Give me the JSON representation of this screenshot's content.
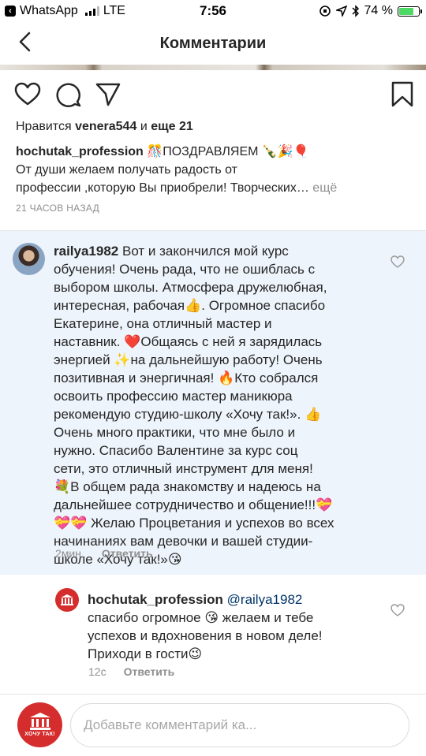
{
  "status_bar": {
    "back_app": "WhatsApp",
    "carrier": "LTE",
    "time": "7:56",
    "battery": "74 %",
    "battery_level": 0.74
  },
  "nav": {
    "title": "Комментарии"
  },
  "post": {
    "likes_prefix": "Нравится",
    "likes_user": "venera544",
    "likes_middle": "и",
    "likes_rest": "еще 21",
    "caption_user": "hochutak_profession",
    "caption_line1": "🎊ПОЗДРАВЛЯЕМ 🍾🎉🎈",
    "caption_line2": "От души желаем  получать радость от",
    "caption_line3": "профессии ,которую Вы приобрели! Творческих…",
    "more_label": "ещё",
    "time_ago": "21 ЧАСОВ НАЗАД"
  },
  "comment": {
    "user": "railya1982",
    "lines": [
      "Вот и закончился мой курс",
      "обучения! Очень рада, что не ошиблась с",
      "выбором школы. Атмосфера дружелюбная,",
      "интересная, рабочая👍. Огромное спасибо",
      "Екатерине, она отличный мастер и",
      "наставник. ❤️Общаясь с ней я зарядилась",
      "энергией ✨на дальнейшую работу!  Очень",
      "позитивная и энергичная! 🔥Кто собрался",
      "освоить профессию мастер маникюра",
      "рекомендую студию-школу «Хочу так!». 👍",
      "Очень много практики, что мне было и",
      "нужно. Спасибо Валентине за курс соц",
      "сети, это отличный инструмент для меня!",
      "💐В общем рада знакомству и надеюсь на",
      "дальнейшее сотрудничество и общение!!!💝",
      "💝💝 Желаю Процветания и успехов во всех",
      "начинаниях вам девочки и вашей студии-",
      "школе «Хочу так!»😘"
    ],
    "time": "2мин.",
    "reply_label": "Ответить"
  },
  "reply": {
    "user": "hochutak_profession",
    "mention": "@railya1982",
    "lines": [
      "спасибо огромное 😘 желаем и тебе",
      "успехов и вдохновения в новом деле!",
      "Приходи в гости😉"
    ],
    "time": "12с",
    "reply_label": "Ответить"
  },
  "composer": {
    "logo_text": "ХОЧУ ТАК!",
    "placeholder": "Добавьте комментарий ка..."
  }
}
